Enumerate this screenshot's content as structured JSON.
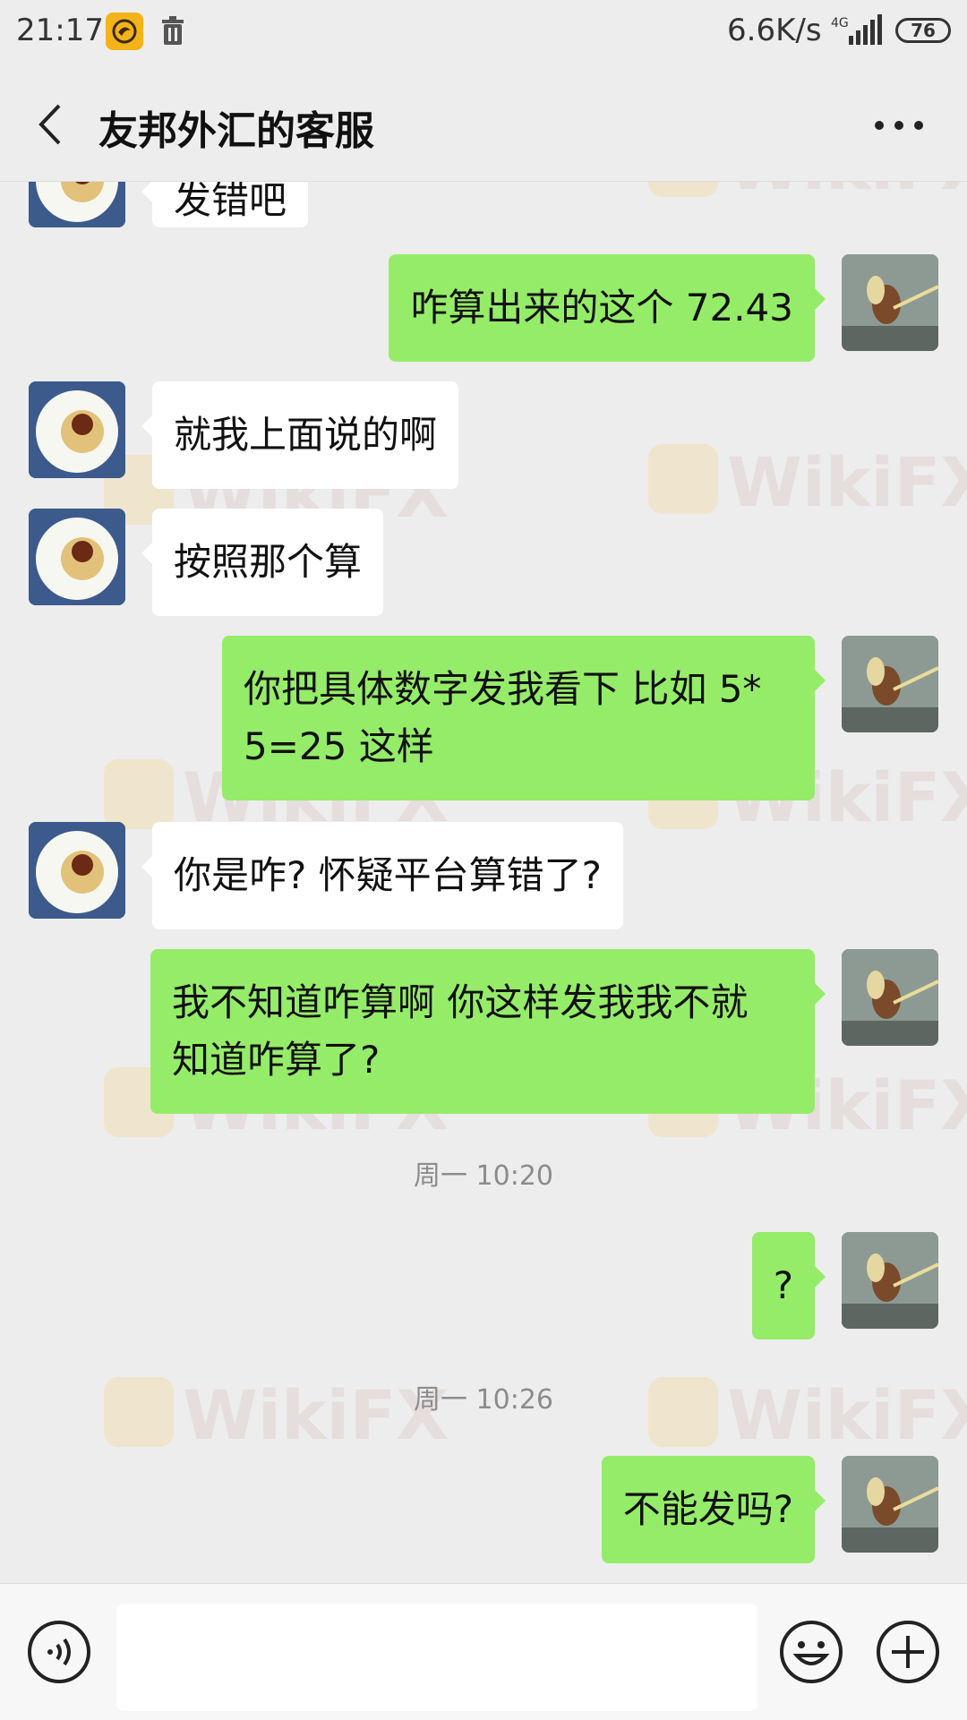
{
  "status_bar": {
    "time": "21:17",
    "net_speed": "6.6K/s",
    "network": "4G",
    "battery": "76",
    "icons": [
      "app-badge-icon",
      "trash-icon",
      "signal-icon",
      "battery-icon"
    ]
  },
  "header": {
    "title": "友邦外汇的客服",
    "back_icon": "chevron-left-icon",
    "more_icon": "more-dots-icon"
  },
  "messages": [
    {
      "side": "left",
      "text": "发错吧"
    },
    {
      "side": "right",
      "text": "咋算出来的这个 72.43"
    },
    {
      "side": "left",
      "text": "就我上面说的啊"
    },
    {
      "side": "left",
      "text": "按照那个算"
    },
    {
      "side": "right",
      "line1": "你把具体数字发我看下 比如 5*",
      "line2": "5=25 这样"
    },
    {
      "side": "left",
      "text": "你是咋? 怀疑平台算错了?"
    },
    {
      "side": "right",
      "line1": "我不知道咋算啊 你这样发我我不就",
      "line2": "知道咋算了?"
    },
    {
      "side": "right",
      "text": "?"
    },
    {
      "side": "right",
      "text": "不能发吗?"
    }
  ],
  "timestamps": [
    "周一 10:20",
    "周一 10:26"
  ],
  "watermark": {
    "text": "WikiFX"
  },
  "input_bar": {
    "placeholder": "",
    "voice_icon": "voice-icon",
    "emoji_icon": "emoji-icon",
    "plus_icon": "plus-icon"
  },
  "colors": {
    "background": "#ededed",
    "outgoing_bubble": "#95ec69",
    "incoming_bubble": "#ffffff",
    "timestamp_text": "#8c8c8c"
  }
}
